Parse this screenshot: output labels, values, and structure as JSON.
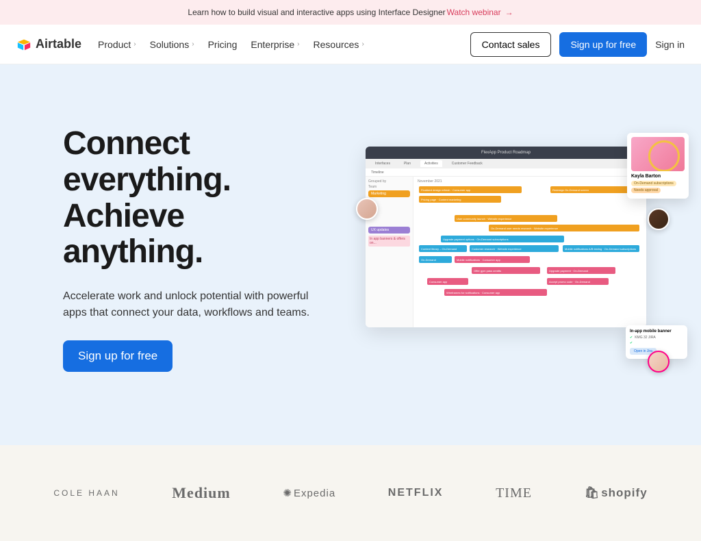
{
  "banner": {
    "text": "Learn how to build visual and interactive apps using Interface Designer",
    "cta": "Watch webinar"
  },
  "brand": "Airtable",
  "nav": {
    "items": [
      "Product",
      "Solutions",
      "Pricing",
      "Enterprise",
      "Resources"
    ],
    "contact": "Contact sales",
    "signup": "Sign up for free",
    "signin": "Sign in"
  },
  "hero": {
    "headline": "Connect everything. Achieve anything.",
    "sub": "Accelerate work and unlock potential with powerful apps that connect your data, workflows and teams.",
    "cta": "Sign up for free"
  },
  "app": {
    "title": "FlexApp Product Roadmap",
    "tabs": [
      "Interfaces",
      "Plan",
      "Activities",
      "Customer Feedback"
    ],
    "toolbar": "Timeline",
    "month": "November 2021",
    "grouped_by": "Grouped by",
    "team": "Team",
    "groups": [
      {
        "label": "Marketing",
        "color": "#f0a020"
      },
      {
        "label": "UX updates",
        "color": "#9b7fd4"
      }
    ],
    "side_items": [
      "In app banners & offers on...",
      ""
    ],
    "bars": [
      {
        "label": "Finalized design refresh · Consumer app",
        "color": "#f0a020"
      },
      {
        "label": "Redesign On-Demand screen",
        "color": "#f0a020"
      },
      {
        "label": "Pricing page · Content marketing",
        "color": "#f0a020"
      },
      {
        "label": "User community launch · Website experience",
        "color": "#f0a020"
      },
      {
        "label": "On-Demand user needs research · Website experience",
        "color": "#f0a020"
      },
      {
        "label": "Upgrade payment options · On-Demand subscriptions",
        "color": "#2daadb"
      },
      {
        "label": "Content library – On-Demand",
        "color": "#2daadb"
      },
      {
        "label": "Customer research · Website experience",
        "color": "#2daadb"
      },
      {
        "label": "Mobile notifications A/B testing · On-Demand subscriptions",
        "color": "#2daadb"
      },
      {
        "label": "On-Demand",
        "color": "#2daadb"
      },
      {
        "label": "Mobile notifications · Consumer app",
        "color": "#e85b81"
      },
      {
        "label": "Offer gym pass credits",
        "color": "#e85b81"
      },
      {
        "label": "Upgrade payment · On-Demand",
        "color": "#e85b81"
      },
      {
        "label": "Consumer app",
        "color": "#e85b81"
      },
      {
        "label": "Accept promo code · On-Demand",
        "color": "#e85b81"
      },
      {
        "label": "Wireframes for notifications · Consumer app",
        "color": "#e85b81"
      }
    ]
  },
  "card1": {
    "name": "Kayla Barton",
    "tag1": "On-Demand subscriptions",
    "tag2": "Needs approval"
  },
  "card2": {
    "title": "In-app mobile banner",
    "row1": "KMG 32 JIRA",
    "jira": "Open in Jira"
  },
  "logos": [
    "COLE HAAN",
    "Medium",
    "Expedia",
    "NETFLIX",
    "TIME",
    "shopify"
  ]
}
